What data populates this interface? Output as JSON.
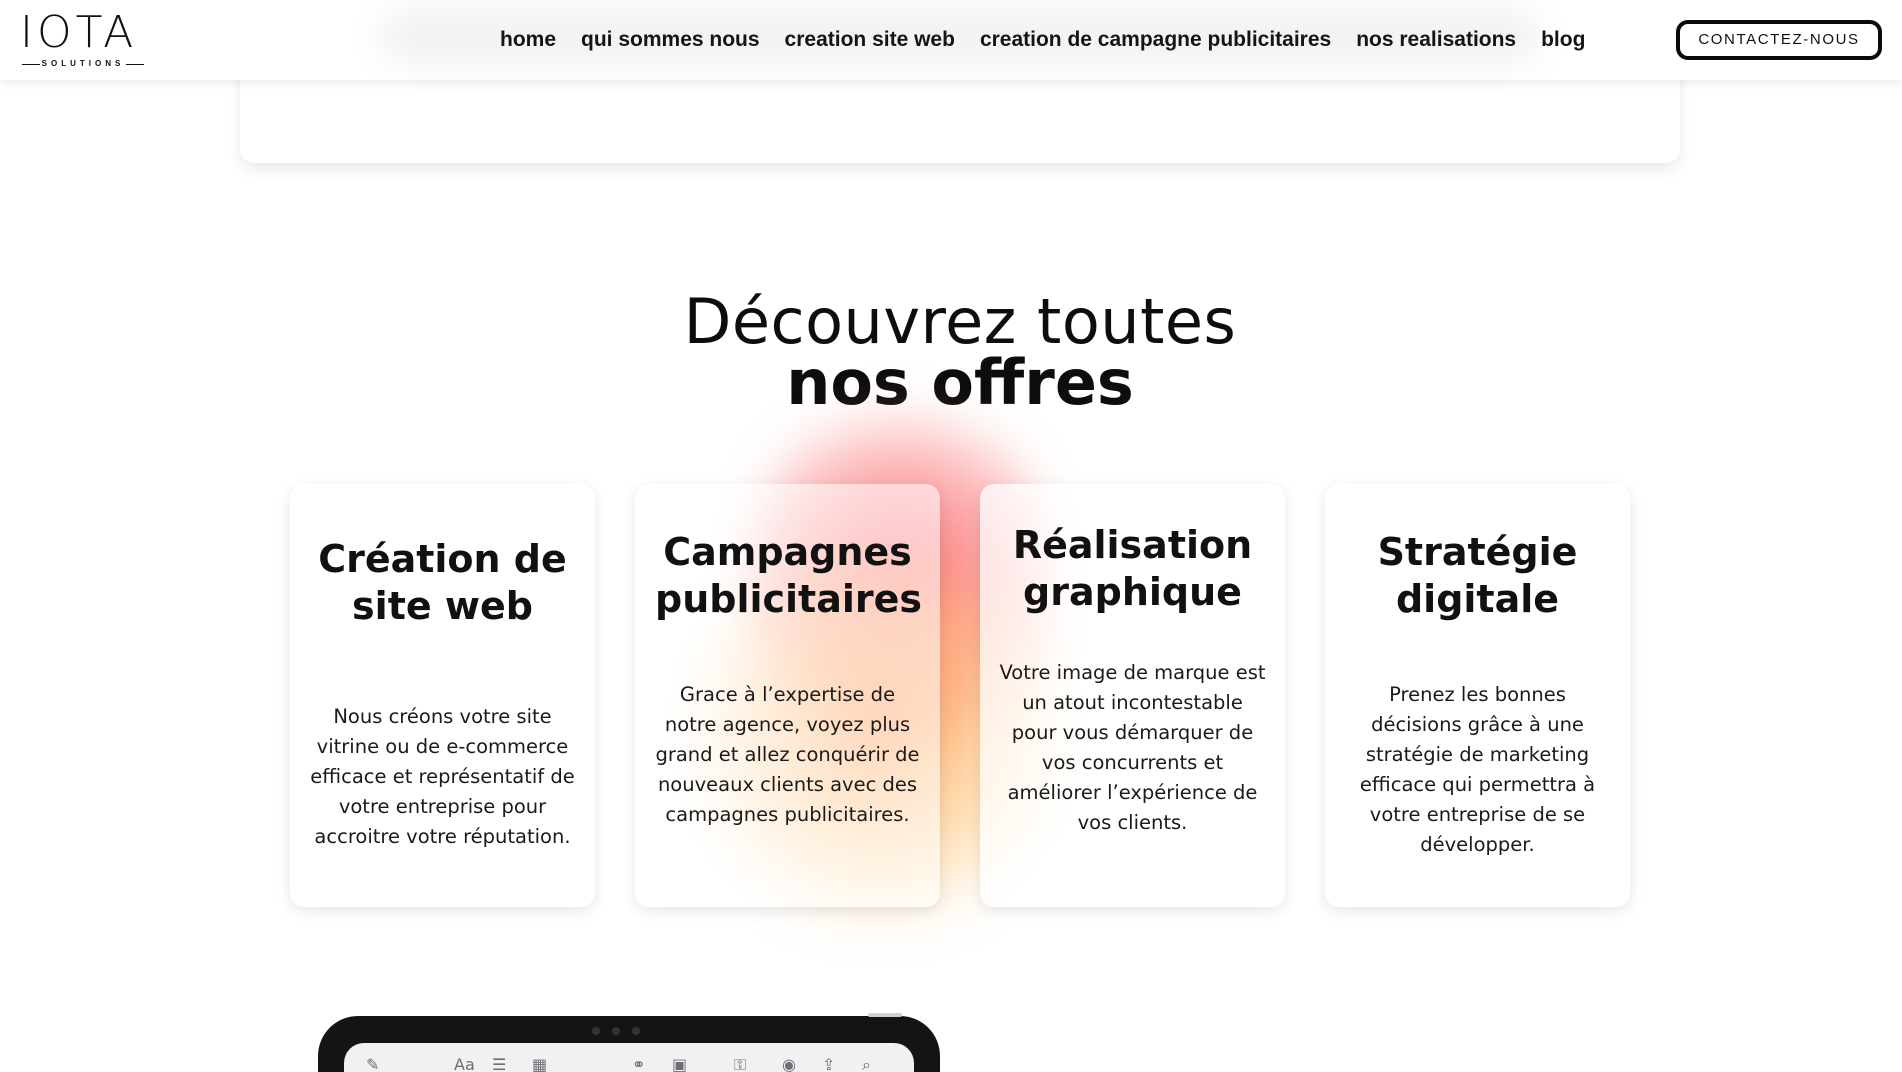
{
  "header": {
    "logo": {
      "wordmark": "IOTA",
      "tagline": "SOLUTIONS"
    },
    "nav": [
      {
        "label": "home"
      },
      {
        "label": "qui sommes nous"
      },
      {
        "label": "creation site web"
      },
      {
        "label": "creation de campagne publicitaires"
      },
      {
        "label": "nos realisations"
      },
      {
        "label": "blog"
      }
    ],
    "contact_label": "CONTACTEZ-NOUS"
  },
  "offers": {
    "heading_line1": "Découvrez toutes",
    "heading_line2": "nos offres",
    "cards": [
      {
        "title": "Création de site web",
        "text": "Nous créons votre site vitrine ou de e-commerce efficace et représentatif de votre entreprise pour accroitre votre réputation."
      },
      {
        "title": "Campagnes publicitaires",
        "text": "Grace à l’expertise de notre agence, voyez plus grand et allez conquérir de nouveaux clients avec des campagnes publicitaires."
      },
      {
        "title": "Réalisation graphique",
        "text": "Votre image de marque est un atout incontestable pour vous démarquer de vos concurrents et améliorer l’expérience de vos clients."
      },
      {
        "title": "Stratégie digitale",
        "text": "Prenez les bonnes décisions grâce à une stratégie de marketing efficace qui permettra à votre entreprise de se développer."
      }
    ]
  },
  "device": {
    "toolbar_icons": [
      "compose-icon",
      "text-format-icon",
      "checklist-icon",
      "table-icon",
      "attachment-icon",
      "media-icon",
      "lock-icon",
      "share-contact-icon",
      "share-icon",
      "search-icon"
    ],
    "text_format_glyph": "Aa"
  },
  "colors": {
    "accent_red": "#fa5a69",
    "accent_orange": "#ff9646",
    "text": "#111111",
    "button_border": "#0a0a0a"
  }
}
